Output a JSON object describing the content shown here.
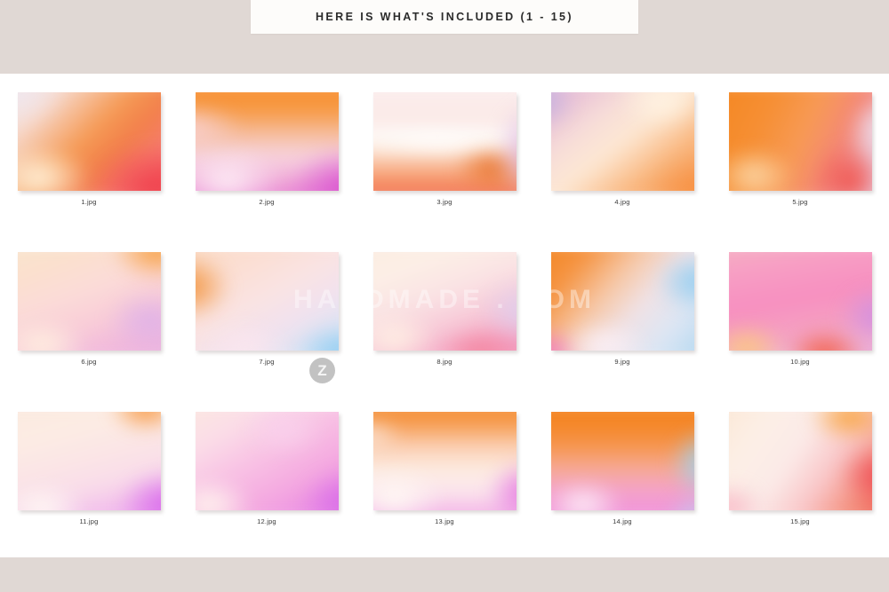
{
  "page": {
    "background_color": "#ffffff",
    "band_color": "#e0d8d4"
  },
  "header": {
    "title": "HERE IS WHAT'S INCLUDED (1 - 15)",
    "banner_color": "#fdfcfa",
    "text_color": "#2b2b2b"
  },
  "watermark": {
    "badge_letter": "Z",
    "text": "HANDMADE . COM"
  },
  "gallery": {
    "rows": [
      {
        "items": [
          {
            "caption": "1.jpg",
            "name": "thumbnail-1",
            "layers": [
              {
                "gradient": "linear-gradient(135deg,#f2eef2 0%,#f7dcd2 22%,#f59a55 48%,#f2804a 62%,#f77c72 78%,#f2504f 100%)",
                "opacity": 1
              },
              {
                "gradient": "radial-gradient(ellipse 42% 38% at 22% 80%, #fff4de 0%, rgba(255,244,222,0) 70%)",
                "opacity": 1
              },
              {
                "gradient": "radial-gradient(ellipse 55% 55% at 88% 88%, #f0414f 0%, rgba(240,65,79,0) 68%)",
                "opacity": 1
              },
              {
                "gradient": "radial-gradient(ellipse 40% 40% at 8% 8%, #efe6ee 0%, rgba(239,230,238,0) 75%)",
                "opacity": 1
              }
            ]
          },
          {
            "caption": "2.jpg",
            "name": "thumbnail-2",
            "layers": [
              {
                "gradient": "linear-gradient(180deg,#f78c2c 0%,#f79a44 24%,#f6bfa3 45%,#f7d5e0 62%,#f0a8d8 84%,#e56fd0 100%)",
                "opacity": 1
              },
              {
                "gradient": "radial-gradient(ellipse 45% 40% at 28% 82%, #fdeef6 0%, rgba(253,238,246,0) 68%)",
                "opacity": 1
              },
              {
                "gradient": "radial-gradient(ellipse 48% 52% at 95% 90%, #d84fd0 0%, rgba(216,79,208,0) 70%)",
                "opacity": 1
              },
              {
                "gradient": "radial-gradient(ellipse 40% 30% at 8% 40%, #f8d0cf 0%, rgba(248,208,207,0) 72%)",
                "opacity": 1
              }
            ]
          },
          {
            "caption": "3.jpg",
            "name": "thumbnail-3",
            "layers": [
              {
                "gradient": "linear-gradient(180deg,#fbeff0 0%,#fbe9e6 32%,#fffdfb 48%,#fbd7c0 62%,#f79a6c 80%,#f1694f 100%)",
                "opacity": 1
              },
              {
                "gradient": "radial-gradient(ellipse 70% 14% at 46% 50%, #ffffff 0%, rgba(255,255,255,0) 72%)",
                "opacity": 1
              },
              {
                "gradient": "radial-gradient(ellipse 30% 26% at 76% 72%, #e8742c 0%, rgba(232,116,44,0) 68%)",
                "opacity": 1
              },
              {
                "gradient": "radial-gradient(ellipse 28% 60% at 98% 58%, #ddb8e4 0%, rgba(221,184,228,0) 70%)",
                "opacity": 1
              }
            ]
          },
          {
            "caption": "4.jpg",
            "name": "thumbnail-4",
            "layers": [
              {
                "gradient": "linear-gradient(142deg,#cdbbe2 0%,#e7bdd6 14%,#f7ddd8 34%,#fde8d4 50%,#f9b47a 72%,#f79148 100%)",
                "opacity": 1
              },
              {
                "gradient": "radial-gradient(ellipse 34% 34% at 72% 16%, #fff3e2 0%, rgba(255,243,226,0) 70%)",
                "opacity": 1
              },
              {
                "gradient": "radial-gradient(ellipse 45% 45% at 95% 92%, #f79040 0%, rgba(247,144,64,0) 70%)",
                "opacity": 1
              },
              {
                "gradient": "radial-gradient(ellipse 26% 30% at 5% 18%, #c5b2e0 0%, rgba(197,178,224,0) 72%)",
                "opacity": 1
              }
            ]
          },
          {
            "caption": "5.jpg",
            "name": "thumbnail-5",
            "layers": [
              {
                "gradient": "linear-gradient(115deg,#f4861f 0%,#f68f34 30%,#f79a55 50%,#f4867a 70%,#ead0e6 88%,#e4dcee 100%)",
                "opacity": 1
              },
              {
                "gradient": "radial-gradient(ellipse 34% 34% at 24% 78%, #fcd8a8 0%, rgba(252,216,168,0) 68%)",
                "opacity": 1
              },
              {
                "gradient": "radial-gradient(ellipse 32% 46% at 78% 82%, #f0504a 0%, rgba(240,80,74,0) 66%)",
                "opacity": 1
              },
              {
                "gradient": "radial-gradient(ellipse 30% 40% at 98% 40%, #ece4f4 0%, rgba(236,228,244,0) 72%)",
                "opacity": 1
              }
            ]
          }
        ]
      },
      {
        "items": [
          {
            "caption": "6.jpg",
            "name": "thumbnail-6",
            "layers": [
              {
                "gradient": "linear-gradient(160deg,#f8e7cf 0%,#fbe0cd 22%,#fbdcd8 42%,#f9cdd8 62%,#f0b6dc 82%,#eab4e2 100%)",
                "opacity": 1
              },
              {
                "gradient": "radial-gradient(ellipse 36% 36% at 88% 8%, #f79d3c 0%, rgba(247,157,60,0) 70%)",
                "opacity": 1
              },
              {
                "gradient": "radial-gradient(ellipse 36% 32% at 24% 86%, #fff0e0 0%, rgba(255,240,224,0) 70%)",
                "opacity": 1
              },
              {
                "gradient": "radial-gradient(ellipse 34% 36% at 84% 66%, #dfb2e8 0%, rgba(223,178,232,0) 70%)",
                "opacity": 1
              }
            ]
          },
          {
            "caption": "7.jpg",
            "name": "thumbnail-7",
            "layers": [
              {
                "gradient": "linear-gradient(150deg,#fbdcc6 0%,#fbded2 26%,#fae3e2 46%,#f2e2ee 64%,#dde4f4 82%,#bedcf4 100%)",
                "opacity": 1
              },
              {
                "gradient": "radial-gradient(ellipse 34% 40% at 6% 38%, #f2923a 0%, rgba(242,146,58,0) 70%)",
                "opacity": 1
              },
              {
                "gradient": "radial-gradient(ellipse 40% 36% at 92% 92%, #8ecdf2 0%, rgba(142,205,242,0) 68%)",
                "opacity": 1
              },
              {
                "gradient": "radial-gradient(ellipse 34% 30% at 38% 88%, #fbe6ee 0%, rgba(251,230,238,0) 72%)",
                "opacity": 1
              }
            ]
          },
          {
            "caption": "8.jpg",
            "name": "thumbnail-8",
            "layers": [
              {
                "gradient": "linear-gradient(160deg,#fbece0 0%,#fcefe6 24%,#fae2e4 46%,#f7c6d6 66%,#f49cc0 86%,#f390b6 100%)",
                "opacity": 1
              },
              {
                "gradient": "radial-gradient(ellipse 34% 32% at 22% 80%, #fff0e4 0%, rgba(255,240,228,0) 70%)",
                "opacity": 1
              },
              {
                "gradient": "radial-gradient(ellipse 34% 40% at 94% 58%, #ded0ef 0%, rgba(222,208,239,0) 70%)",
                "opacity": 1
              },
              {
                "gradient": "radial-gradient(ellipse 34% 30% at 70% 92%, #f4859e 0%, rgba(244,133,158,0) 70%)",
                "opacity": 1
              }
            ]
          },
          {
            "caption": "9.jpg",
            "name": "thumbnail-9",
            "layers": [
              {
                "gradient": "linear-gradient(130deg,#f2841e 0%,#f59340 22%,#f6c8a8 42%,#f0e2e6 58%,#dce6f4 76%,#a8d4ef 100%)",
                "opacity": 1
              },
              {
                "gradient": "radial-gradient(ellipse 34% 36% at 92% 34%, #92cdf0 0%, rgba(146,205,240,0) 70%)",
                "opacity": 1
              },
              {
                "gradient": "radial-gradient(ellipse 28% 30% at 8% 92%, #ef74c4 0%, rgba(239,116,196,0) 70%)",
                "opacity": 1
              },
              {
                "gradient": "radial-gradient(ellipse 34% 28% at 40% 86%, #fbf0f6 0%, rgba(251,240,246,0) 72%)",
                "opacity": 1
              }
            ]
          },
          {
            "caption": "10.jpg",
            "name": "thumbnail-10",
            "layers": [
              {
                "gradient": "linear-gradient(170deg,#f5b5c2 0%,#f79ec4 24%,#f78fc0 48%,#f5a0c2 68%,#f0b4d4 86%,#e49ce0 100%)",
                "opacity": 1
              },
              {
                "gradient": "radial-gradient(ellipse 32% 30% at 20% 88%, #fcc97e 0%, rgba(252,201,126,0) 68%)",
                "opacity": 1
              },
              {
                "gradient": "radial-gradient(ellipse 34% 34% at 64% 94%, #f4593e 0%, rgba(244,89,62,0) 68%)",
                "opacity": 1
              },
              {
                "gradient": "radial-gradient(ellipse 32% 36% at 94% 62%, #cf8ee4 0%, rgba(207,142,228,0) 70%)",
                "opacity": 1
              }
            ]
          }
        ]
      },
      {
        "items": [
          {
            "caption": "11.jpg",
            "name": "thumbnail-11",
            "layers": [
              {
                "gradient": "linear-gradient(165deg,#fbeade 0%,#fcece4 28%,#fbe5e6 48%,#f9dcea 66%,#f0b6ec 86%,#e47cf0 100%)",
                "opacity": 1
              },
              {
                "gradient": "radial-gradient(ellipse 30% 30% at 82% 6%, #f79134 0%, rgba(247,145,52,0) 70%)",
                "opacity": 1
              },
              {
                "gradient": "radial-gradient(ellipse 34% 32% at 24% 90%, #fffaf4 0%, rgba(255,250,244,0) 72%)",
                "opacity": 1
              },
              {
                "gradient": "radial-gradient(ellipse 40% 42% at 94% 86%, #d868ec 0%, rgba(216,104,236,0) 68%)",
                "opacity": 1
              }
            ]
          },
          {
            "caption": "12.jpg",
            "name": "thumbnail-12",
            "layers": [
              {
                "gradient": "linear-gradient(150deg,#fbeade 0%,#fbdde8 26%,#f8c0e4 48%,#f4a8e0 68%,#ea8ce4 86%,#e07ce8 100%)",
                "opacity": 1
              },
              {
                "gradient": "radial-gradient(ellipse 34% 32% at 18% 86%, #fff6ee 0%, rgba(255,246,238,0) 72%)",
                "opacity": 1
              },
              {
                "gradient": "radial-gradient(ellipse 36% 40% at 94% 84%, #d86ce8 0%, rgba(216,108,232,0) 68%)",
                "opacity": 1
              },
              {
                "gradient": "radial-gradient(ellipse 30% 30% at 60% 24%, #f9d0ec 0%, rgba(249,208,236,0) 72%)",
                "opacity": 1
              }
            ]
          },
          {
            "caption": "13.jpg",
            "name": "thumbnail-13",
            "layers": [
              {
                "gradient": "linear-gradient(180deg,#f4892a 0%,#f69a4c 18%,#fbcfb4 38%,#fdeee4 58%,#fbe2ee 78%,#f0a0e4 100%)",
                "opacity": 1
              },
              {
                "gradient": "radial-gradient(ellipse 38% 34% at 22% 80%, #fffaf4 0%, rgba(255,250,244,0) 72%)",
                "opacity": 1
              },
              {
                "gradient": "radial-gradient(ellipse 34% 42% at 96% 76%, #e472e0 0%, rgba(228,114,224,0) 66%)",
                "opacity": 1
              },
              {
                "gradient": "radial-gradient(ellipse 26% 22% at 8% 30%, #fbe2d2 0%, rgba(251,226,210,0) 72%)",
                "opacity": 1
              }
            ]
          },
          {
            "caption": "14.jpg",
            "name": "thumbnail-14",
            "layers": [
              {
                "gradient": "linear-gradient(180deg,#f4821c 0%,#f5882a 22%,#f69856 40%,#f6aa96 56%,#f4a2ce 76%,#ef8ede 100%)",
                "opacity": 1
              },
              {
                "gradient": "radial-gradient(ellipse 30% 46% at 96% 52%, #9ad4f2 0%, rgba(154,212,242,0) 66%)",
                "opacity": 1
              },
              {
                "gradient": "radial-gradient(ellipse 32% 30% at 28% 86%, #fdf0f8 0%, rgba(253,240,248,0) 70%)",
                "opacity": 1
              },
              {
                "gradient": "radial-gradient(ellipse 26% 28% at 92% 96%, #c0c8f0 0%, rgba(192,200,240,0) 70%)",
                "opacity": 1
              }
            ]
          },
          {
            "caption": "15.jpg",
            "name": "thumbnail-15",
            "layers": [
              {
                "gradient": "linear-gradient(125deg,#fbe6d2 0%,#fcefe6 26%,#fbeae8 46%,#f9c6c8 64%,#f4907e 82%,#f0584e 100%)",
                "opacity": 1
              },
              {
                "gradient": "radial-gradient(ellipse 34% 30% at 78% 14%, #f9a43c 0%, rgba(249,164,60,0) 68%)",
                "opacity": 1
              },
              {
                "gradient": "radial-gradient(ellipse 36% 40% at 96% 62%, #ef4a54 0%, rgba(239,74,84,0) 66%)",
                "opacity": 1
              },
              {
                "gradient": "radial-gradient(ellipse 28% 28% at 10% 88%, #f9b8c6 0%, rgba(249,184,198,0) 72%)",
                "opacity": 1
              }
            ]
          }
        ]
      }
    ]
  }
}
